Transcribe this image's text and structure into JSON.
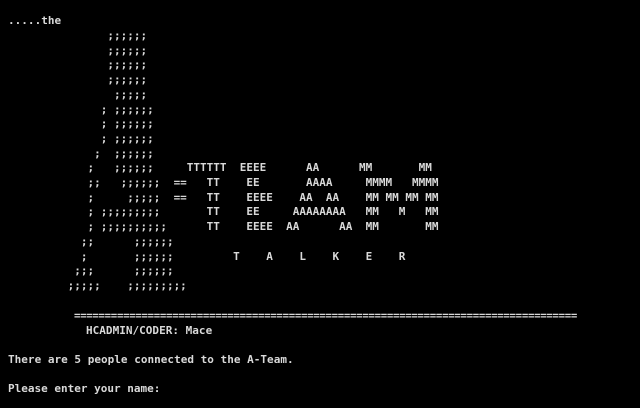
{
  "terminal": {
    "intro": ".....the",
    "banner_art": "               ;;;;;;\n               ;;;;;;\n               ;;;;;;\n               ;;;;;;\n                ;;;;;\n              ; ;;;;;;\n              ; ;;;;;;\n              ; ;;;;;;\n             ;  ;;;;;;\n            ;   ;;;;;;     TTTTTT  EEEE      AA      MM       MM\n            ;;   ;;;;;;  ==   TT    EE       AAAA     MMMM   MMMM\n            ;     ;;;;;  ==   TT    EEEE    AA  AA    MM MM MM MM\n            ; ;;;;;;;;;       TT    EE     AAAAAAAA   MM   M   MM\n            ; ;;;;;;;;;;      TT    EEEE  AA      AA  MM       MM\n           ;;      ;;;;;;\n           ;       ;;;;;;         T    A    L    K    E    R\n          ;;;      ;;;;;;\n         ;;;;;    ;;;;;;;;;",
    "divider": "==================================================================================",
    "credit": "HCADMIN/CODER: Mace",
    "connected_message": "There are 5 people connected to the A-Team.",
    "name_prompt": "Please enter your name: "
  },
  "colors": {
    "background": "#000000",
    "text": "#d9d9d9"
  }
}
